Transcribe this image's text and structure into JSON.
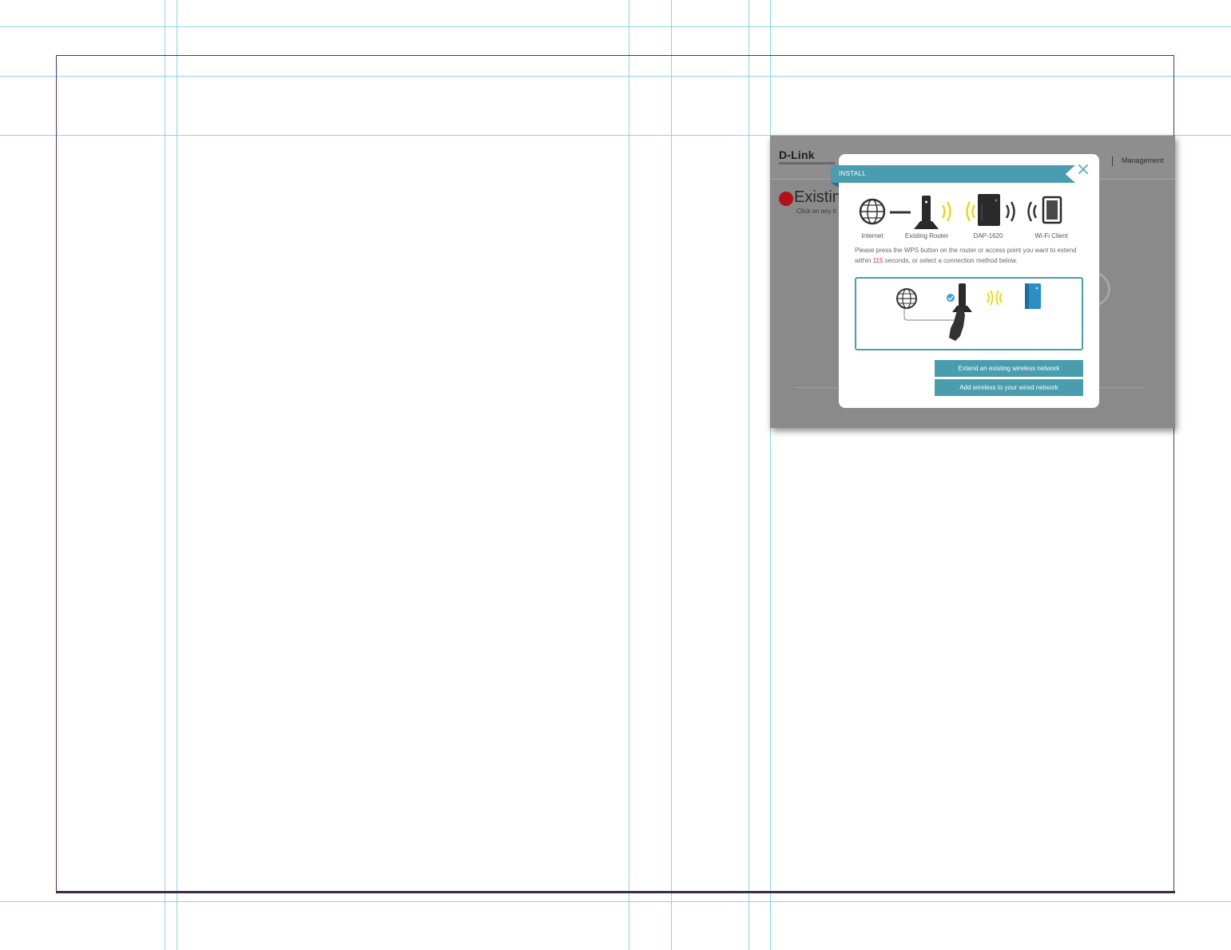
{
  "app": {
    "logo": "D-Link",
    "nav_management": "Management"
  },
  "background_page": {
    "title": "Existin",
    "subtitle": "Click on any it"
  },
  "modal": {
    "title": "INSTALL",
    "diagram": {
      "internet": "Internet",
      "router": "Existing Router",
      "device": "DAP-1620",
      "client": "Wi-Fi Client"
    },
    "instruction_before": "Please press the WPS button on the router or access point you want to extend within ",
    "seconds": "115",
    "instruction_after": " seconds, or select a connection method below.",
    "buttons": {
      "extend": "Extend an existing wireless network",
      "add_wireless": "Add wireless to your wired network"
    }
  },
  "colors": {
    "accent": "#4a9caf",
    "countdown": "#d92b2b",
    "brand_red": "#b0121a",
    "signal_yellow": "#e8d820"
  }
}
